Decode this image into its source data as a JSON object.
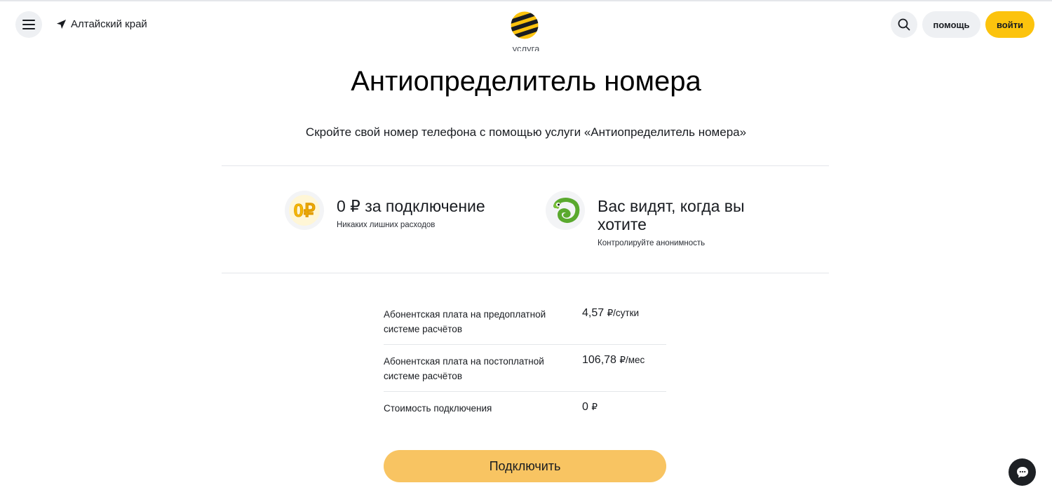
{
  "header": {
    "region": "Алтайский край",
    "help_label": "помощь",
    "login_label": "войти",
    "eyebrow": "услуга"
  },
  "page": {
    "title": "Антиопределитель номера",
    "subtitle": "Скройте свой номер телефона с помощью услуги «Антиопределитель номера»"
  },
  "features": [
    {
      "title": "0 ₽ за подключение",
      "desc": "Никаких лишних расходов",
      "icon": "zero-ruble-coin-icon",
      "icon_text": "0₽"
    },
    {
      "title": "Вас видят, когда вы хотите",
      "desc": "Контролируйте анонимность",
      "icon": "chameleon-icon"
    }
  ],
  "prices": [
    {
      "label": "Абонентская плата на предоплатной системе расчётов",
      "value": "4,57",
      "unit": "₽/сутки"
    },
    {
      "label": "Абонентская плата на постоплатной системе расчётов",
      "value": "106,78",
      "unit": "₽/мес"
    },
    {
      "label": "Стоимость подключения",
      "value": "0",
      "unit": "₽"
    }
  ],
  "cta": {
    "label": "Подключить"
  },
  "colors": {
    "brand_yellow": "#fcc30d",
    "cta_yellow": "#f8c462",
    "dark": "#191c21"
  }
}
